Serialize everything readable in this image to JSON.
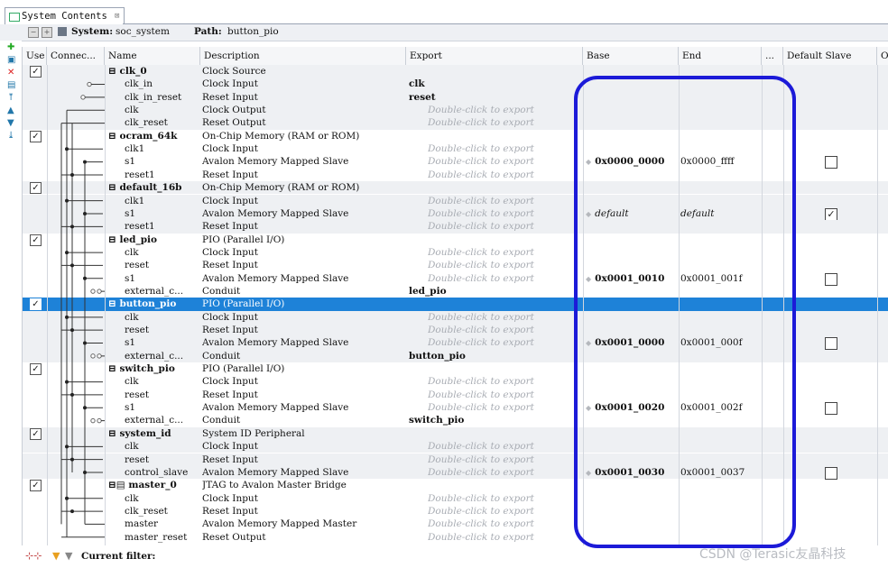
{
  "tab": {
    "label": "System Contents",
    "close": "⊠"
  },
  "system_bar": {
    "system_label": "System:",
    "system_name": "soc_system",
    "path_label": "Path:",
    "path_value": "button_pio"
  },
  "columns": {
    "use": "Use",
    "connections": "Connec...",
    "name": "Name",
    "description": "Description",
    "export": "Export",
    "base": "Base",
    "end": "End",
    "irq": "...",
    "default_slave": "Default Slave",
    "opcode": "O"
  },
  "rows": [
    {
      "name": "⊟ clk_0",
      "desc": "Clock Source",
      "export": "",
      "hint": false,
      "comp": true,
      "use": true,
      "shade": true
    },
    {
      "name": "clk_in",
      "desc": "Clock Input",
      "export": "clk",
      "hint": false,
      "comp": false,
      "shade": true
    },
    {
      "name": "clk_in_reset",
      "desc": "Reset Input",
      "export": "reset",
      "hint": false,
      "comp": false,
      "shade": true
    },
    {
      "name": "clk",
      "desc": "Clock Output",
      "export": "Double-click to export",
      "hint": true,
      "comp": false,
      "shade": true
    },
    {
      "name": "clk_reset",
      "desc": "Reset Output",
      "export": "Double-click to export",
      "hint": true,
      "comp": false,
      "shade": true
    },
    {
      "name": "⊟ ocram_64k",
      "desc": "On-Chip Memory (RAM or ROM)",
      "export": "",
      "hint": false,
      "comp": true,
      "use": true,
      "shade": false
    },
    {
      "name": "clk1",
      "desc": "Clock Input",
      "export": "Double-click to export",
      "hint": true,
      "comp": false,
      "shade": false
    },
    {
      "name": "s1",
      "desc": "Avalon Memory Mapped Slave",
      "export": "Double-click to export",
      "hint": true,
      "comp": false,
      "shade": false,
      "base": "0x0000_0000",
      "end": "0x0000_ffff",
      "dslave": false
    },
    {
      "name": "reset1",
      "desc": "Reset Input",
      "export": "Double-click to export",
      "hint": true,
      "comp": false,
      "shade": false
    },
    {
      "name": "⊟ default_16b",
      "desc": "On-Chip Memory (RAM or ROM)",
      "export": "",
      "hint": false,
      "comp": true,
      "use": true,
      "shade": true
    },
    {
      "name": "clk1",
      "desc": "Clock Input",
      "export": "Double-click to export",
      "hint": true,
      "comp": false,
      "shade": true
    },
    {
      "name": "s1",
      "desc": "Avalon Memory Mapped Slave",
      "export": "Double-click to export",
      "hint": true,
      "comp": false,
      "shade": true,
      "base": "default",
      "end": "default",
      "italic_addr": true,
      "dslave": true
    },
    {
      "name": "reset1",
      "desc": "Reset Input",
      "export": "Double-click to export",
      "hint": true,
      "comp": false,
      "shade": true
    },
    {
      "name": "⊟ led_pio",
      "desc": "PIO (Parallel I/O)",
      "export": "",
      "hint": false,
      "comp": true,
      "use": true,
      "shade": false
    },
    {
      "name": "clk",
      "desc": "Clock Input",
      "export": "Double-click to export",
      "hint": true,
      "comp": false,
      "shade": false
    },
    {
      "name": "reset",
      "desc": "Reset Input",
      "export": "Double-click to export",
      "hint": true,
      "comp": false,
      "shade": false
    },
    {
      "name": "s1",
      "desc": "Avalon Memory Mapped Slave",
      "export": "Double-click to export",
      "hint": true,
      "comp": false,
      "shade": false,
      "base": "0x0001_0010",
      "end": "0x0001_001f",
      "dslave": false
    },
    {
      "name": "external_c...",
      "desc": "Conduit",
      "export": "led_pio",
      "hint": false,
      "comp": false,
      "shade": false
    },
    {
      "name": "⊟ button_pio",
      "desc": "PIO (Parallel I/O)",
      "export": "",
      "hint": false,
      "comp": true,
      "use": true,
      "selected": true,
      "shade": false
    },
    {
      "name": "clk",
      "desc": "Clock Input",
      "export": "Double-click to export",
      "hint": true,
      "comp": false,
      "shade": true
    },
    {
      "name": "reset",
      "desc": "Reset Input",
      "export": "Double-click to export",
      "hint": true,
      "comp": false,
      "shade": true
    },
    {
      "name": "s1",
      "desc": "Avalon Memory Mapped Slave",
      "export": "Double-click to export",
      "hint": true,
      "comp": false,
      "shade": true,
      "base": "0x0001_0000",
      "end": "0x0001_000f",
      "dslave": false
    },
    {
      "name": "external_c...",
      "desc": "Conduit",
      "export": "button_pio",
      "hint": false,
      "comp": false,
      "shade": true
    },
    {
      "name": "⊟ switch_pio",
      "desc": "PIO (Parallel I/O)",
      "export": "",
      "hint": false,
      "comp": true,
      "use": true,
      "shade": false
    },
    {
      "name": "clk",
      "desc": "Clock Input",
      "export": "Double-click to export",
      "hint": true,
      "comp": false,
      "shade": false
    },
    {
      "name": "reset",
      "desc": "Reset Input",
      "export": "Double-click to export",
      "hint": true,
      "comp": false,
      "shade": false
    },
    {
      "name": "s1",
      "desc": "Avalon Memory Mapped Slave",
      "export": "Double-click to export",
      "hint": true,
      "comp": false,
      "shade": false,
      "base": "0x0001_0020",
      "end": "0x0001_002f",
      "dslave": false
    },
    {
      "name": "external_c...",
      "desc": "Conduit",
      "export": "switch_pio",
      "hint": false,
      "comp": false,
      "shade": false
    },
    {
      "name": "⊟ system_id",
      "desc": "System ID Peripheral",
      "export": "",
      "hint": false,
      "comp": true,
      "use": true,
      "shade": true
    },
    {
      "name": "clk",
      "desc": "Clock Input",
      "export": "Double-click to export",
      "hint": true,
      "comp": false,
      "shade": true
    },
    {
      "name": "reset",
      "desc": "Reset Input",
      "export": "Double-click to export",
      "hint": true,
      "comp": false,
      "shade": true
    },
    {
      "name": "control_slave",
      "desc": "Avalon Memory Mapped Slave",
      "export": "Double-click to export",
      "hint": true,
      "comp": false,
      "shade": true,
      "base": "0x0001_0030",
      "end": "0x0001_0037",
      "dslave": false
    },
    {
      "name": "⊟▤ master_0",
      "desc": "JTAG to Avalon Master Bridge",
      "export": "",
      "hint": false,
      "comp": true,
      "use": true,
      "shade": false
    },
    {
      "name": "clk",
      "desc": "Clock Input",
      "export": "Double-click to export",
      "hint": true,
      "comp": false,
      "shade": false
    },
    {
      "name": "clk_reset",
      "desc": "Reset Input",
      "export": "Double-click to export",
      "hint": true,
      "comp": false,
      "shade": false
    },
    {
      "name": "master",
      "desc": "Avalon Memory Mapped Master",
      "export": "Double-click to export",
      "hint": true,
      "comp": false,
      "shade": false
    },
    {
      "name": "master_reset",
      "desc": "Reset Output",
      "export": "Double-click to export",
      "hint": true,
      "comp": false,
      "shade": false
    }
  ],
  "status_bar": {
    "filter_label": "Current filter:"
  },
  "watermark": "CSDN @Terasic友晶科技",
  "colors": {
    "selection": "#1e82d8",
    "annotation": "#1c1ad8",
    "shade": "#eef0f3"
  }
}
